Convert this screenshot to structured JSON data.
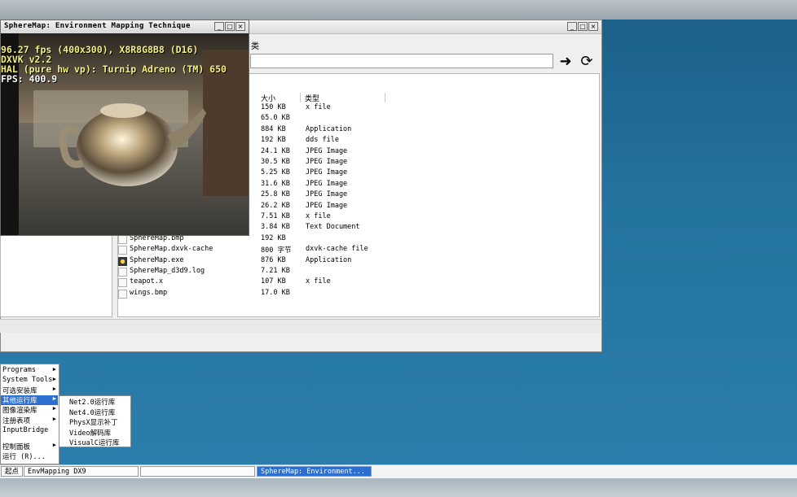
{
  "render_window": {
    "title": "SphereMap: Environment Mapping Technique",
    "hud": [
      "96.27 fps (400x300), X8R8G8B8 (D16)",
      "DXVK v2.2",
      "HAL (pure hw vp): Turnip Adreno (TM) 650",
      "FPS:  400.9"
    ],
    "hud_colors": [
      "#f4f07a",
      "#f4f07a",
      "#f4f07a",
      "#ffffff"
    ],
    "buttons": [
      "_",
      "□",
      "×"
    ]
  },
  "file_manager": {
    "window_buttons": [
      "_",
      "□",
      "×"
    ],
    "menu_fragment": "类",
    "nav": {
      "go_icon": "arrow-right-icon",
      "refresh_icon": "refresh-icon",
      "go_glyph": "➜",
      "refresh_glyph": "⟳"
    },
    "columns": {
      "size": "大小",
      "type": "类型"
    },
    "rows": [
      {
        "name": "",
        "size": "150 KB",
        "type": "x file"
      },
      {
        "name": "",
        "size": "65.0 KB",
        "type": ""
      },
      {
        "name": "",
        "size": "884 KB",
        "type": "Application"
      },
      {
        "name": "",
        "size": "192 KB",
        "type": "dds file"
      },
      {
        "name": "",
        "size": "24.1 KB",
        "type": "JPEG Image"
      },
      {
        "name": "",
        "size": "30.5 KB",
        "type": "JPEG Image"
      },
      {
        "name": "",
        "size": "5.25 KB",
        "type": "JPEG Image"
      },
      {
        "name": "",
        "size": "31.6 KB",
        "type": "JPEG Image"
      },
      {
        "name": "",
        "size": "25.8 KB",
        "type": "JPEG Image"
      },
      {
        "name": "",
        "size": "26.2 KB",
        "type": "JPEG Image"
      },
      {
        "name": "",
        "size": "7.51 KB",
        "type": "x file"
      },
      {
        "name": "",
        "size": "3.84 KB",
        "type": "Text Document"
      },
      {
        "name": "SphereMap.bmp",
        "size": "192 KB",
        "type": ""
      },
      {
        "name": "SphereMap.dxvk-cache",
        "size": "800 字节",
        "type": "dxvk-cache file"
      },
      {
        "name": "SphereMap.exe",
        "size": "876 KB",
        "type": "Application",
        "icon": "exe"
      },
      {
        "name": "SphereMap_d3d9.log",
        "size": "7.21 KB",
        "type": ""
      },
      {
        "name": "teapot.x",
        "size": "107 KB",
        "type": "x file"
      },
      {
        "name": "wings.bmp",
        "size": "17.0 KB",
        "type": ""
      }
    ]
  },
  "start_menu": {
    "items": [
      {
        "label": "Programs",
        "arrow": true
      },
      {
        "label": "System Tools",
        "arrow": true
      },
      {
        "label": "可选安装库",
        "arrow": true
      },
      {
        "label": "其他运行库",
        "arrow": true,
        "selected": true
      },
      {
        "label": "图像渲染库",
        "arrow": true
      },
      {
        "label": "注册表项",
        "arrow": true
      },
      {
        "label": "InputBridge",
        "arrow": false
      },
      {
        "label": "控制面板",
        "arrow": true
      },
      {
        "label": "运行 (R)...",
        "arrow": false
      }
    ],
    "submenu": [
      "Net2.0运行库",
      "Net4.0运行库",
      "PhysX显示补丁",
      "Video解码库",
      "VisualC运行库"
    ],
    "arrow_glyph": "▶"
  },
  "taskbar": {
    "start": "起点",
    "tasks": [
      "EnvMapping DX9",
      "",
      "SphereMap: Environment..."
    ]
  }
}
